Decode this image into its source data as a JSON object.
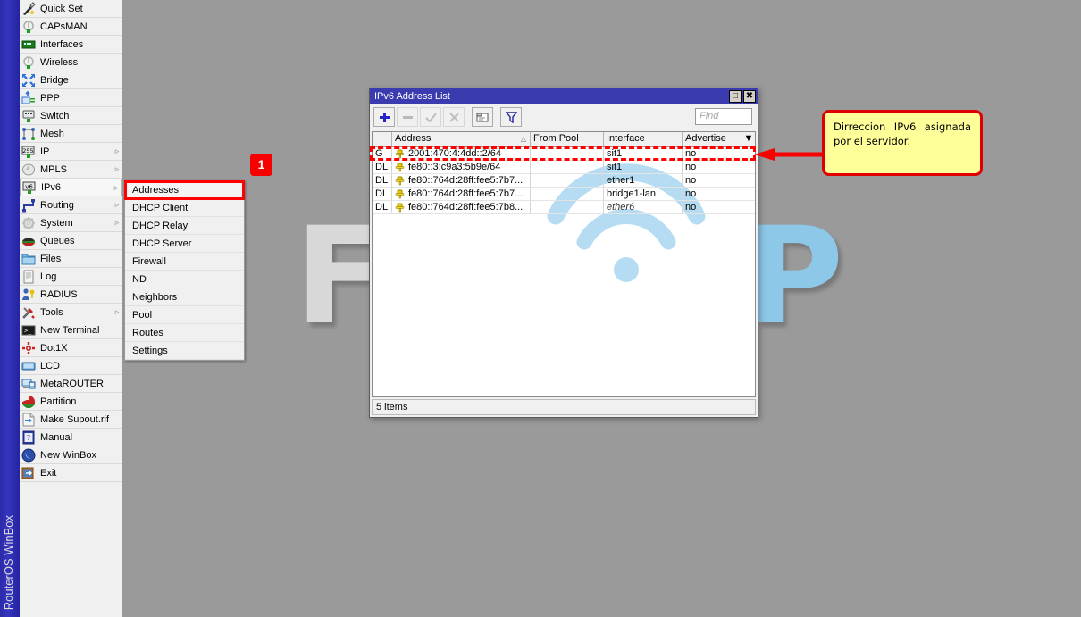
{
  "app": {
    "rail_label": "RouterOS WinBox"
  },
  "sidebar": {
    "items": [
      {
        "label": "Quick Set",
        "icon": "wand-icon",
        "arrow": ""
      },
      {
        "label": "CAPsMAN",
        "icon": "capsman-icon",
        "arrow": ""
      },
      {
        "label": "Interfaces",
        "icon": "nic-card-icon",
        "arrow": ""
      },
      {
        "label": "Wireless",
        "icon": "antenna-icon",
        "arrow": ""
      },
      {
        "label": "Bridge",
        "icon": "bridge-icon",
        "arrow": ""
      },
      {
        "label": "PPP",
        "icon": "ppp-icon",
        "arrow": ""
      },
      {
        "label": "Switch",
        "icon": "switch-icon",
        "arrow": ""
      },
      {
        "label": "Mesh",
        "icon": "mesh-icon",
        "arrow": ""
      },
      {
        "label": "IP",
        "icon": "ip-255-icon",
        "arrow": "▹"
      },
      {
        "label": "MPLS",
        "icon": "mpls-icon",
        "arrow": "▹"
      },
      {
        "label": "IPv6",
        "icon": "ipv6-icon",
        "arrow": "▹"
      },
      {
        "label": "Routing",
        "icon": "routing-icon",
        "arrow": "▹"
      },
      {
        "label": "System",
        "icon": "gear-icon",
        "arrow": "▹"
      },
      {
        "label": "Queues",
        "icon": "queues-icon",
        "arrow": ""
      },
      {
        "label": "Files",
        "icon": "folder-icon",
        "arrow": ""
      },
      {
        "label": "Log",
        "icon": "log-icon",
        "arrow": ""
      },
      {
        "label": "RADIUS",
        "icon": "radius-icon",
        "arrow": ""
      },
      {
        "label": "Tools",
        "icon": "tools-icon",
        "arrow": "▹"
      },
      {
        "label": "New Terminal",
        "icon": "terminal-icon",
        "arrow": ""
      },
      {
        "label": "Dot1X",
        "icon": "dot1x-icon",
        "arrow": ""
      },
      {
        "label": "LCD",
        "icon": "lcd-icon",
        "arrow": ""
      },
      {
        "label": "MetaROUTER",
        "icon": "metarouter-icon",
        "arrow": ""
      },
      {
        "label": "Partition",
        "icon": "partition-icon",
        "arrow": ""
      },
      {
        "label": "Make Supout.rif",
        "icon": "supout-icon",
        "arrow": ""
      },
      {
        "label": "Manual",
        "icon": "manual-icon",
        "arrow": ""
      },
      {
        "label": "New WinBox",
        "icon": "winbox-icon",
        "arrow": ""
      },
      {
        "label": "Exit",
        "icon": "exit-icon",
        "arrow": ""
      }
    ],
    "selected_index": 10
  },
  "submenu": {
    "parent": "IPv6",
    "items": [
      {
        "label": "Addresses",
        "highlighted": true
      },
      {
        "label": "DHCP Client",
        "highlighted": false
      },
      {
        "label": "DHCP Relay",
        "highlighted": false
      },
      {
        "label": "DHCP Server",
        "highlighted": false
      },
      {
        "label": "Firewall",
        "highlighted": false
      },
      {
        "label": "ND",
        "highlighted": false
      },
      {
        "label": "Neighbors",
        "highlighted": false
      },
      {
        "label": "Pool",
        "highlighted": false
      },
      {
        "label": "Routes",
        "highlighted": false
      },
      {
        "label": "Settings",
        "highlighted": false
      }
    ]
  },
  "annotations": {
    "step_badge": "1",
    "callout_text": "Dirreccion IPv6 asignada por el servidor.",
    "accent_red": "#f70000",
    "callout_bg": "#ffff99"
  },
  "window": {
    "title": "IPv6 Address List",
    "titlebar_color": "#3b3bb0",
    "buttons": {
      "maximize": "□",
      "close": "✖"
    },
    "toolbar": [
      {
        "name": "add-button",
        "glyph": "+",
        "enabled": true
      },
      {
        "name": "remove-button",
        "glyph": "–",
        "enabled": false
      },
      {
        "name": "enable-button",
        "glyph": "✓",
        "enabled": false
      },
      {
        "name": "disable-button",
        "glyph": "✗",
        "enabled": false
      },
      {
        "name": "comment-button",
        "glyph": "⌸",
        "enabled": true
      },
      {
        "name": "filter-button",
        "glyph": "▽",
        "enabled": true
      }
    ],
    "find": {
      "placeholder": "Find",
      "value": ""
    },
    "table": {
      "columns": [
        "",
        "Address",
        "From Pool",
        "Interface",
        "Advertise",
        ""
      ],
      "sort_column": "Address",
      "rows": [
        {
          "flag": "G",
          "address": "2001:470:4:4dd::2/64",
          "from_pool": "",
          "interface": "sit1",
          "advertise": "no",
          "dim": false,
          "highlighted": true
        },
        {
          "flag": "DL",
          "address": "fe80::3:c9a3:5b9e/64",
          "from_pool": "",
          "interface": "sit1",
          "advertise": "no",
          "dim": false,
          "highlighted": false
        },
        {
          "flag": "DL",
          "address": "fe80::764d:28ff:fee5:7b7...",
          "from_pool": "",
          "interface": "ether1",
          "advertise": "no",
          "dim": false,
          "highlighted": false
        },
        {
          "flag": "DL",
          "address": "fe80::764d:28ff:fee5:7b7...",
          "from_pool": "",
          "interface": "bridge1-lan",
          "advertise": "no",
          "dim": false,
          "highlighted": false
        },
        {
          "flag": "DL",
          "address": "fe80::764d:28ff:fee5:7b8...",
          "from_pool": "",
          "interface": "ether6",
          "advertise": "no",
          "dim": true,
          "highlighted": false
        }
      ]
    },
    "status": "5 items"
  },
  "watermark": {
    "part1": "Foro",
    "part2": "ISP",
    "color1": "#d8d8d8",
    "color2": "#8ec8e8"
  }
}
